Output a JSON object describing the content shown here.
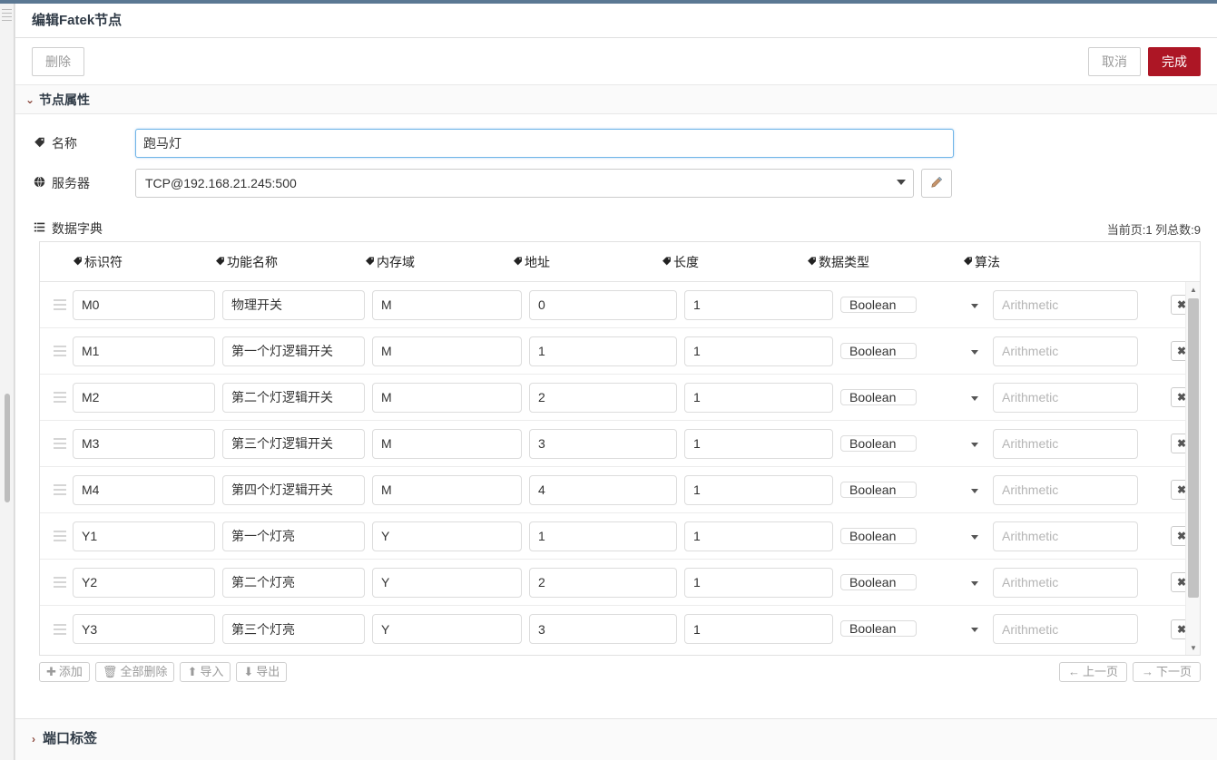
{
  "dialog": {
    "title": "编辑Fatek节点",
    "toolbar": {
      "delete_label": "删除",
      "cancel_label": "取消",
      "done_label": "完成",
      "done_color": "#ad1625"
    }
  },
  "sections": {
    "properties": {
      "label": "节点属性",
      "chevron": "chevron-down-icon",
      "chevron_glyph": "⌄"
    },
    "port_labels": {
      "label": "端口标签",
      "chevron": "chevron-right-icon",
      "chevron_glyph": "›"
    }
  },
  "form": {
    "name": {
      "label": "名称",
      "icon": "tag-icon",
      "icon_glyph": "🏷",
      "value": "跑马灯",
      "placeholder": "名称"
    },
    "server": {
      "label": "服务器",
      "icon": "globe-icon",
      "icon_glyph": "🌐",
      "value": "TCP@192.168.21.245:500",
      "edit_icon": "pencil-icon"
    }
  },
  "dictionary": {
    "title": "数据字典",
    "title_icon": "list-icon",
    "meta": "当前页:1  列总数:9",
    "current_page_label": "当前页:1",
    "total_columns_label": "列总数:9",
    "columns": [
      {
        "label": "标识符",
        "icon": "tag-icon"
      },
      {
        "label": "功能名称",
        "icon": "tag-icon"
      },
      {
        "label": "内存域",
        "icon": "tag-icon"
      },
      {
        "label": "地址",
        "icon": "tag-icon"
      },
      {
        "label": "长度",
        "icon": "tag-icon"
      },
      {
        "label": "数据类型",
        "icon": "tag-icon"
      },
      {
        "label": "算法",
        "icon": "tag-icon"
      }
    ],
    "algorithm_placeholder": "Arithmetic",
    "rows": [
      {
        "ident": "M0",
        "func": "物理开关",
        "mem": "M",
        "addr": "0",
        "len": "1",
        "type": "Boolean",
        "algo": ""
      },
      {
        "ident": "M1",
        "func": "第一个灯逻辑开关",
        "mem": "M",
        "addr": "1",
        "len": "1",
        "type": "Boolean",
        "algo": ""
      },
      {
        "ident": "M2",
        "func": "第二个灯逻辑开关",
        "mem": "M",
        "addr": "2",
        "len": "1",
        "type": "Boolean",
        "algo": ""
      },
      {
        "ident": "M3",
        "func": "第三个灯逻辑开关",
        "mem": "M",
        "addr": "3",
        "len": "1",
        "type": "Boolean",
        "algo": ""
      },
      {
        "ident": "M4",
        "func": "第四个灯逻辑开关",
        "mem": "M",
        "addr": "4",
        "len": "1",
        "type": "Boolean",
        "algo": ""
      },
      {
        "ident": "Y1",
        "func": "第一个灯亮",
        "mem": "Y",
        "addr": "1",
        "len": "1",
        "type": "Boolean",
        "algo": ""
      },
      {
        "ident": "Y2",
        "func": "第二个灯亮",
        "mem": "Y",
        "addr": "2",
        "len": "1",
        "type": "Boolean",
        "algo": ""
      },
      {
        "ident": "Y3",
        "func": "第三个灯亮",
        "mem": "Y",
        "addr": "3",
        "len": "1",
        "type": "Boolean",
        "algo": ""
      }
    ],
    "row_delete_glyph": "✖",
    "footer": {
      "add": "添加",
      "delete_all": "全部删除",
      "import": "导入",
      "export": "导出",
      "prev_page": "上一页",
      "next_page": "下一页"
    }
  }
}
